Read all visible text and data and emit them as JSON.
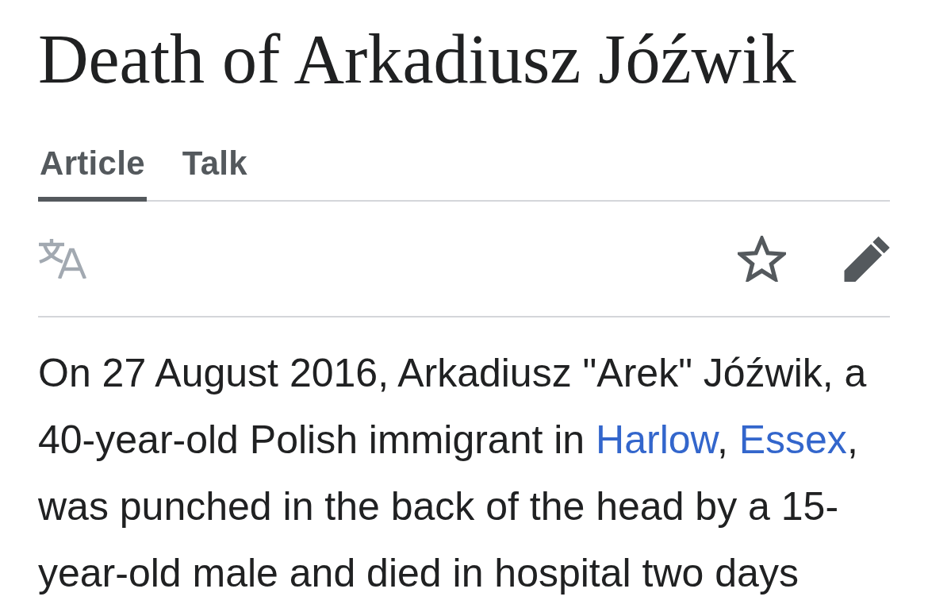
{
  "title": "Death of Arkadiusz Jóźwik",
  "tabs": [
    {
      "label": "Article",
      "selected": true
    },
    {
      "label": "Talk",
      "selected": false
    }
  ],
  "page_actions": [
    {
      "kind": "language",
      "disabled": true
    },
    {
      "kind": "watch",
      "selected": false
    },
    {
      "kind": "edit",
      "disabled": false
    }
  ],
  "paragraph": [
    {
      "kind": "text",
      "text": "On 27 August 2016, Arkadiusz \"Arek\" Jóźwik, a 40-year-old Polish immigrant in "
    },
    {
      "kind": "link",
      "text": "Harlow"
    },
    {
      "kind": "text",
      "text": ", "
    },
    {
      "kind": "link",
      "text": "Essex"
    },
    {
      "kind": "text",
      "text": ", was punched in the back of the head by a 15-year-old male and died in hospital two days"
    }
  ]
}
